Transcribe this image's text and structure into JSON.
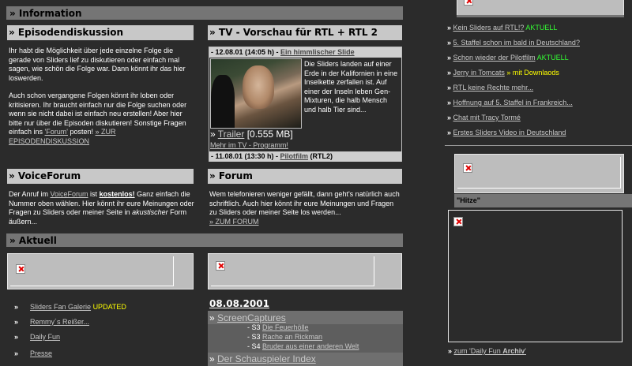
{
  "info_band": "» Information",
  "episodes": {
    "title": "» Episodendiskussion",
    "p1": "Ihr habt die Möglichkeit über jede einzelne Folge die gerade von Sliders lief zu diskutieren oder einfach mal sagen, wie schön die Folge war. Dann könnt ihr das hier loswerden.",
    "p2_a": "Auch schon vergangene Folgen könnt ihr loben oder kritisieren. Ihr braucht einfach nur die Folge suchen oder wenn sie nicht dabei ist einfach neu erstellen! Aber hier bitte nur über die Episoden diskutieren! Sonstige Fragen einfach ins ",
    "p2_link": "'Forum'",
    "p2_b": " posten! ",
    "link": "» ZUR EPISODENDISKUSSION"
  },
  "tv": {
    "title": "» TV - Vorschau für RTL + RTL 2",
    "entry1_date": "- 12.08.01 (14:05 h) - ",
    "entry1_title": "Ein himmlischer Slide",
    "entry1_desc": "Die Sliders landen auf einer Erde in der Kalifornien in eine Inselkette zerfallen ist. Auf einer der Inseln leben Gen-Mixturen, die halb Mensch und halb Tier sind...",
    "trailer_label": "Trailer",
    "trailer_size": "[0.555 MB]",
    "more": "Mehr im TV - Programm!",
    "entry2_date": "- 11.08.01 (13:30 h) - ",
    "entry2_title": "Pilotfilm",
    "entry2_channel": " (RTL2)"
  },
  "voiceforum": {
    "title": "» VoiceForum",
    "t1": "Der Anruf im ",
    "t1_link": "VoiceForum",
    "t2": " ist ",
    "t2_bold": "kostenlos!",
    "t3": "  Ganz einfach die Nummer oben wählen. Hier könnt ihr eure Meinungen oder Fragen zu Sliders oder meiner Seite in ",
    "t3_italic": "akustischer",
    "t4": " Form äußern..."
  },
  "forum": {
    "title": "» Forum",
    "text": "Wem telefonieren weniger gefällt, dann geht's natürlich auch schriftlich. Auch hier könnt ihr eure Meinungen und Fragen zu Sliders oder meiner Seite los werden...",
    "link": "» ZUM FORUM"
  },
  "aktuell_band": "» Aktuell",
  "left_list": [
    {
      "label": "Sliders Fan Galerie",
      "badge": "UPDATED"
    },
    {
      "label": "Remmy´s Reißer...",
      "badge": ""
    },
    {
      "label": "Daily Fun",
      "badge": ""
    },
    {
      "label": "Presse",
      "badge": ""
    }
  ],
  "date_heading": "08.08.2001",
  "screencaps": {
    "title": "ScreenCaptures",
    "items": [
      {
        "prefix": "- S3 ",
        "label": "Die Feuerhölle"
      },
      {
        "prefix": "- S3 ",
        "label": "Rache an Rickman"
      },
      {
        "prefix": "- S4 ",
        "label": "Bruder aus einer anderen Welt"
      }
    ],
    "next": "Der Schauspieler Index"
  },
  "news": [
    {
      "label": "Kein Sliders auf RTL!?",
      "badge": "AKTUELL",
      "badge_color": "#33ff33"
    },
    {
      "label": "5. Staffel schon im bald in Deutschland?",
      "badge": "",
      "badge_color": ""
    },
    {
      "label": "Schon wieder der Pilotfilm",
      "badge": "AKTUELL",
      "badge_color": "#33ff33"
    },
    {
      "label": "Jerry in Tomcats",
      "badge": "» mit Downlaods",
      "badge_color": "#ffff00"
    },
    {
      "label": "RTL keine Rechte mehr...",
      "badge": "",
      "badge_color": ""
    },
    {
      "label": "Hoffnung auf 5. Staffel in Frankreich...",
      "badge": "",
      "badge_color": ""
    },
    {
      "label": "Chat mit Tracy Tormé",
      "badge": "",
      "badge_color": ""
    },
    {
      "label": "Erstes Sliders Video in Deutschland",
      "badge": "",
      "badge_color": ""
    }
  ],
  "hitze_label": "\"Hitze\"",
  "daily_fun": {
    "prefix": "» ",
    "link_a": "zum 'Daily Fun ",
    "link_b": "Archiv",
    "link_c": "'"
  }
}
